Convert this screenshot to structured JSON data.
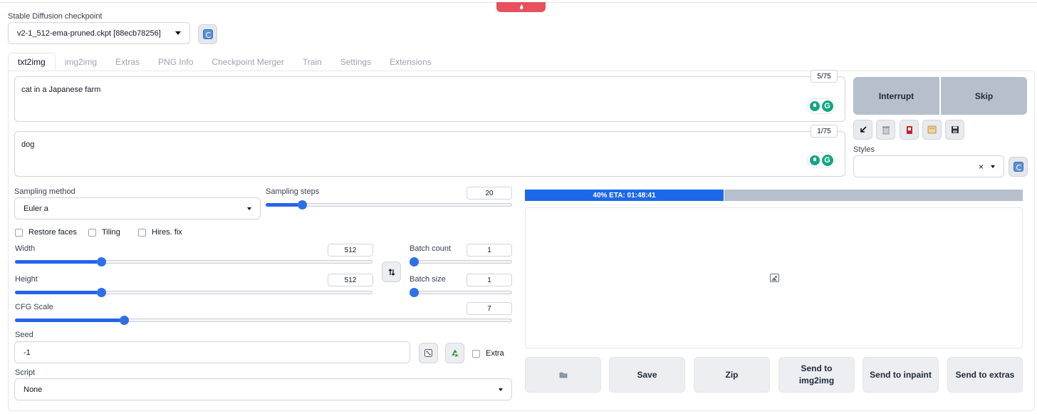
{
  "checkpoint": {
    "label": "Stable Diffusion checkpoint",
    "value": "v2-1_512-ema-pruned.ckpt [88ecb78256]"
  },
  "tabs": [
    {
      "label": "txt2img",
      "active": true
    },
    {
      "label": "img2img"
    },
    {
      "label": "Extras"
    },
    {
      "label": "PNG Info"
    },
    {
      "label": "Checkpoint Merger"
    },
    {
      "label": "Train"
    },
    {
      "label": "Settings"
    },
    {
      "label": "Extensions"
    }
  ],
  "prompt": {
    "text": "cat in a Japanese farm",
    "token_count": "5/75"
  },
  "negative_prompt": {
    "text": "dog",
    "token_count": "1/75"
  },
  "actions": {
    "interrupt": "Interrupt",
    "skip": "Skip"
  },
  "styles": {
    "label": "Styles",
    "clear_glyph": "×"
  },
  "sampling": {
    "method_label": "Sampling method",
    "method_value": "Euler a",
    "steps_label": "Sampling steps",
    "steps_value": "20",
    "steps_fraction": 0.13
  },
  "checks": {
    "restore_faces": "Restore faces",
    "tiling": "Tiling",
    "hires_fix": "Hires. fix"
  },
  "width": {
    "label": "Width",
    "value": "512",
    "fraction": 0.23
  },
  "height": {
    "label": "Height",
    "value": "512",
    "fraction": 0.23
  },
  "batch_count": {
    "label": "Batch count",
    "value": "1",
    "fraction": 0.0
  },
  "batch_size": {
    "label": "Batch size",
    "value": "1",
    "fraction": 0.0
  },
  "cfg": {
    "label": "CFG Scale",
    "value": "7",
    "fraction": 0.21
  },
  "seed": {
    "label": "Seed",
    "value": "-1",
    "extra_label": "Extra"
  },
  "script": {
    "label": "Script",
    "value": "None"
  },
  "progress": {
    "text": "40% ETA: 01:48:41",
    "fraction": 0.4
  },
  "output_buttons": {
    "save": "Save",
    "zip": "Zip",
    "send_img2img_line1": "Send to",
    "send_img2img_line2": "img2img",
    "send_inpaint": "Send to inpaint",
    "send_extras": "Send to extras"
  },
  "colors": {
    "accent": "#2563eb",
    "interrupt_bg": "#b6bfcb",
    "grammarly": "#15a683"
  }
}
